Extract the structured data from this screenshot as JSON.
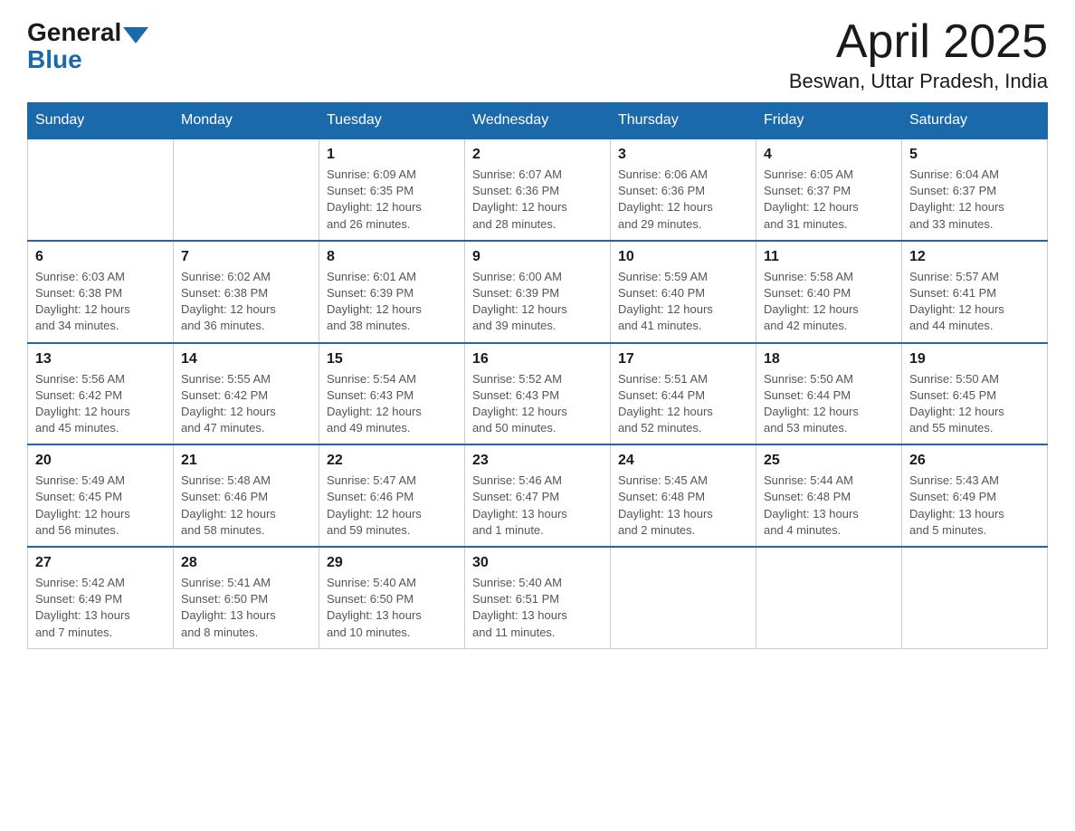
{
  "header": {
    "logo": {
      "general_text": "General",
      "blue_text": "Blue"
    },
    "title": "April 2025",
    "location": "Beswan, Uttar Pradesh, India"
  },
  "calendar": {
    "days_of_week": [
      "Sunday",
      "Monday",
      "Tuesday",
      "Wednesday",
      "Thursday",
      "Friday",
      "Saturday"
    ],
    "weeks": [
      [
        {
          "day": "",
          "info": ""
        },
        {
          "day": "",
          "info": ""
        },
        {
          "day": "1",
          "info": "Sunrise: 6:09 AM\nSunset: 6:35 PM\nDaylight: 12 hours\nand 26 minutes."
        },
        {
          "day": "2",
          "info": "Sunrise: 6:07 AM\nSunset: 6:36 PM\nDaylight: 12 hours\nand 28 minutes."
        },
        {
          "day": "3",
          "info": "Sunrise: 6:06 AM\nSunset: 6:36 PM\nDaylight: 12 hours\nand 29 minutes."
        },
        {
          "day": "4",
          "info": "Sunrise: 6:05 AM\nSunset: 6:37 PM\nDaylight: 12 hours\nand 31 minutes."
        },
        {
          "day": "5",
          "info": "Sunrise: 6:04 AM\nSunset: 6:37 PM\nDaylight: 12 hours\nand 33 minutes."
        }
      ],
      [
        {
          "day": "6",
          "info": "Sunrise: 6:03 AM\nSunset: 6:38 PM\nDaylight: 12 hours\nand 34 minutes."
        },
        {
          "day": "7",
          "info": "Sunrise: 6:02 AM\nSunset: 6:38 PM\nDaylight: 12 hours\nand 36 minutes."
        },
        {
          "day": "8",
          "info": "Sunrise: 6:01 AM\nSunset: 6:39 PM\nDaylight: 12 hours\nand 38 minutes."
        },
        {
          "day": "9",
          "info": "Sunrise: 6:00 AM\nSunset: 6:39 PM\nDaylight: 12 hours\nand 39 minutes."
        },
        {
          "day": "10",
          "info": "Sunrise: 5:59 AM\nSunset: 6:40 PM\nDaylight: 12 hours\nand 41 minutes."
        },
        {
          "day": "11",
          "info": "Sunrise: 5:58 AM\nSunset: 6:40 PM\nDaylight: 12 hours\nand 42 minutes."
        },
        {
          "day": "12",
          "info": "Sunrise: 5:57 AM\nSunset: 6:41 PM\nDaylight: 12 hours\nand 44 minutes."
        }
      ],
      [
        {
          "day": "13",
          "info": "Sunrise: 5:56 AM\nSunset: 6:42 PM\nDaylight: 12 hours\nand 45 minutes."
        },
        {
          "day": "14",
          "info": "Sunrise: 5:55 AM\nSunset: 6:42 PM\nDaylight: 12 hours\nand 47 minutes."
        },
        {
          "day": "15",
          "info": "Sunrise: 5:54 AM\nSunset: 6:43 PM\nDaylight: 12 hours\nand 49 minutes."
        },
        {
          "day": "16",
          "info": "Sunrise: 5:52 AM\nSunset: 6:43 PM\nDaylight: 12 hours\nand 50 minutes."
        },
        {
          "day": "17",
          "info": "Sunrise: 5:51 AM\nSunset: 6:44 PM\nDaylight: 12 hours\nand 52 minutes."
        },
        {
          "day": "18",
          "info": "Sunrise: 5:50 AM\nSunset: 6:44 PM\nDaylight: 12 hours\nand 53 minutes."
        },
        {
          "day": "19",
          "info": "Sunrise: 5:50 AM\nSunset: 6:45 PM\nDaylight: 12 hours\nand 55 minutes."
        }
      ],
      [
        {
          "day": "20",
          "info": "Sunrise: 5:49 AM\nSunset: 6:45 PM\nDaylight: 12 hours\nand 56 minutes."
        },
        {
          "day": "21",
          "info": "Sunrise: 5:48 AM\nSunset: 6:46 PM\nDaylight: 12 hours\nand 58 minutes."
        },
        {
          "day": "22",
          "info": "Sunrise: 5:47 AM\nSunset: 6:46 PM\nDaylight: 12 hours\nand 59 minutes."
        },
        {
          "day": "23",
          "info": "Sunrise: 5:46 AM\nSunset: 6:47 PM\nDaylight: 13 hours\nand 1 minute."
        },
        {
          "day": "24",
          "info": "Sunrise: 5:45 AM\nSunset: 6:48 PM\nDaylight: 13 hours\nand 2 minutes."
        },
        {
          "day": "25",
          "info": "Sunrise: 5:44 AM\nSunset: 6:48 PM\nDaylight: 13 hours\nand 4 minutes."
        },
        {
          "day": "26",
          "info": "Sunrise: 5:43 AM\nSunset: 6:49 PM\nDaylight: 13 hours\nand 5 minutes."
        }
      ],
      [
        {
          "day": "27",
          "info": "Sunrise: 5:42 AM\nSunset: 6:49 PM\nDaylight: 13 hours\nand 7 minutes."
        },
        {
          "day": "28",
          "info": "Sunrise: 5:41 AM\nSunset: 6:50 PM\nDaylight: 13 hours\nand 8 minutes."
        },
        {
          "day": "29",
          "info": "Sunrise: 5:40 AM\nSunset: 6:50 PM\nDaylight: 13 hours\nand 10 minutes."
        },
        {
          "day": "30",
          "info": "Sunrise: 5:40 AM\nSunset: 6:51 PM\nDaylight: 13 hours\nand 11 minutes."
        },
        {
          "day": "",
          "info": ""
        },
        {
          "day": "",
          "info": ""
        },
        {
          "day": "",
          "info": ""
        }
      ]
    ]
  }
}
